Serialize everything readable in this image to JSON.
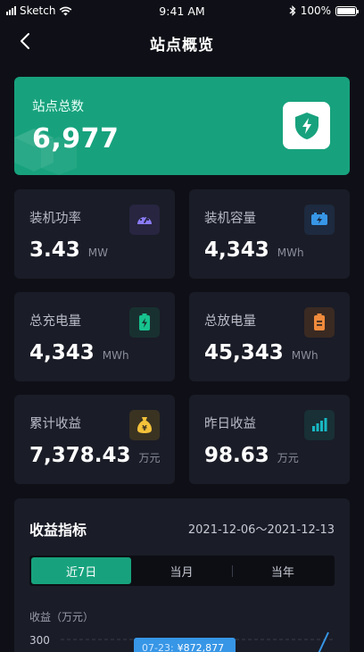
{
  "status_bar": {
    "carrier": "Sketch",
    "time": "9:41 AM",
    "battery": "100%",
    "battery_level": 1.0,
    "icons": [
      "signal-icon",
      "wifi-icon",
      "bluetooth-icon",
      "battery-icon"
    ]
  },
  "nav": {
    "back_icon": "chevron-left-icon",
    "title": "站点概览"
  },
  "hero": {
    "label": "站点总数",
    "value": "6,977",
    "icon": "shield-bolt-icon",
    "bg_color": "#17a27d"
  },
  "cards": [
    {
      "label": "装机功率",
      "value": "3.43",
      "unit": "MW",
      "icon": "gauge-icon",
      "icon_color": "#8b7cf6",
      "icon_bg": "#272540"
    },
    {
      "label": "装机容量",
      "value": "4,343",
      "unit": "MWh",
      "icon": "battery-bolt-icon",
      "icon_color": "#3796e6",
      "icon_bg": "#1d2a3f"
    },
    {
      "label": "总充电量",
      "value": "4,343",
      "unit": "MWh",
      "icon": "battery-charge-icon",
      "icon_color": "#17c28f",
      "icon_bg": "#183130"
    },
    {
      "label": "总放电量",
      "value": "45,343",
      "unit": "MWh",
      "icon": "battery-discharge-icon",
      "icon_color": "#f08a3c",
      "icon_bg": "#3a2a22"
    },
    {
      "label": "累计收益",
      "value": "7,378.43",
      "unit": "万元",
      "icon": "money-bag-icon",
      "icon_color": "#f4c23a",
      "icon_bg": "#3a3322"
    },
    {
      "label": "昨日收益",
      "value": "98.63",
      "unit": "万元",
      "icon": "bar-chart-icon",
      "icon_color": "#18b8c4",
      "icon_bg": "#183036"
    }
  ],
  "panel": {
    "title": "收益指标",
    "date_range": "2021-12-06～2021-12-13",
    "tabs": [
      {
        "label": "近7日",
        "active": true
      },
      {
        "label": "当月",
        "active": false
      },
      {
        "label": "当年",
        "active": false
      }
    ],
    "accent": "#17a27d",
    "chart": {
      "y_axis_label": "收益（万元）",
      "top_tick": "300",
      "tooltip_date": "07-23:",
      "tooltip_value": "¥872,877"
    }
  }
}
